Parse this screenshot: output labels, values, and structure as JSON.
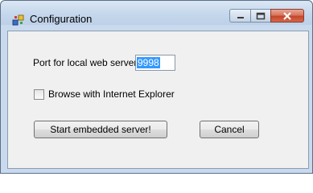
{
  "window": {
    "title": "Configuration",
    "icon": "application-icon"
  },
  "form": {
    "port_label": "Port for local web server",
    "port_value": "9998",
    "browse_checkbox_label": "Browse with Internet Explorer",
    "browse_checked": false,
    "start_button_label": "Start embedded server!",
    "cancel_button_label": "Cancel"
  },
  "colors": {
    "selection": "#3399ff",
    "close_button": "#c6452b"
  }
}
